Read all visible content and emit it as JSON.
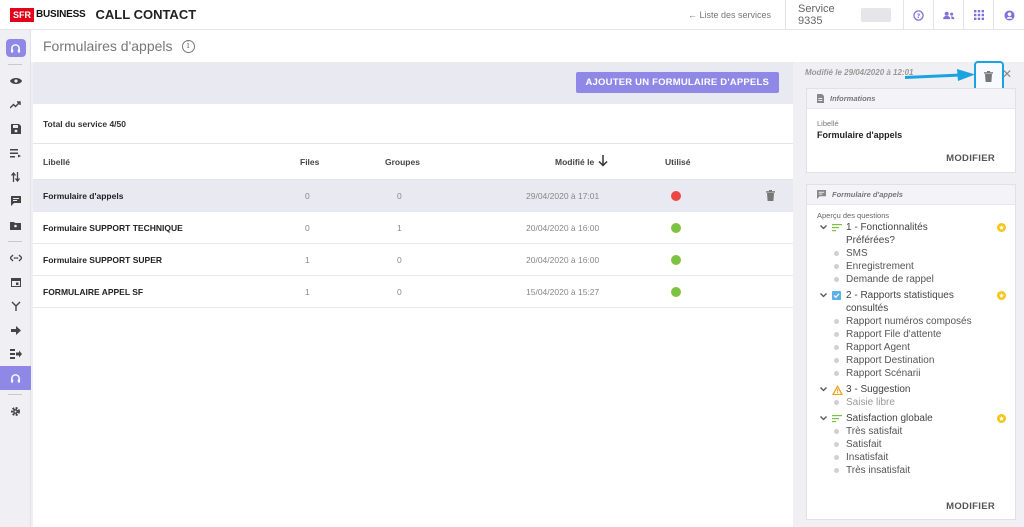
{
  "app": {
    "brand_box": "SFR",
    "brand_text": "BUSINESS",
    "title": "CALL CONTACT"
  },
  "topbar": {
    "back_link": "← Liste des services",
    "service_label": "Service 9335",
    "icons": [
      "help-icon",
      "users-icon",
      "apps-grid-icon",
      "account-icon"
    ]
  },
  "sidebar": {
    "icons": [
      "headset-icon",
      "eye-icon",
      "trend-icon",
      "save-icon",
      "queue-icon",
      "transfer-icon",
      "message-icon",
      "contact-card-icon",
      "code-icon",
      "calendar-icon",
      "branch-icon",
      "forward-icon",
      "list-forward-icon",
      "headset-icon",
      "settings-icon"
    ]
  },
  "page": {
    "title": "Formulaires d'appels"
  },
  "main": {
    "add_button": "AJOUTER UN FORMULAIRE D'APPELS",
    "total": "Total du service 4/50",
    "columns": {
      "libelle": "Libellé",
      "files": "Files",
      "groupes": "Groupes",
      "modifie": "Modifié le",
      "utilise": "Utilisé"
    },
    "rows": [
      {
        "libelle": "Formulaire d'appels",
        "files": "0",
        "groupes": "0",
        "modifie": "29/04/2020 à 17:01",
        "utilise": "red"
      },
      {
        "libelle": "Formulaire SUPPORT TECHNIQUE",
        "files": "0",
        "groupes": "1",
        "modifie": "20/04/2020 à 16:00",
        "utilise": "green"
      },
      {
        "libelle": "Formulaire SUPPORT SUPER",
        "files": "1",
        "groupes": "0",
        "modifie": "20/04/2020 à 16:00",
        "utilise": "green"
      },
      {
        "libelle": "FORMULAIRE APPEL SF",
        "files": "1",
        "groupes": "0",
        "modifie": "15/04/2020 à 15:27",
        "utilise": "green"
      }
    ],
    "colors": {
      "red": "#ef4444",
      "green": "#7cc243"
    }
  },
  "panel": {
    "modified": "Modifié le 29/04/2020 à 12:01",
    "info_title": "Informations",
    "libelle_label": "Libellé",
    "libelle_value": "Formulaire d'appels",
    "modify": "MODIFIER",
    "form_title": "Formulaire d'appels",
    "apercu": "Aperçu des questions",
    "q1": {
      "label": "1 - Fonctionnalités",
      "label2": "Préférées?",
      "options": [
        "SMS",
        "Enregistrement",
        "Demande de rappel"
      ]
    },
    "q2": {
      "label": "2 - Rapports statistiques",
      "label2": "consultés",
      "options": [
        "Rapport numéros composés",
        "Rapport File d'attente",
        "Rapport Agent",
        "Rapport Destination",
        "Rapport Scénarii"
      ]
    },
    "q3": {
      "label": "3 - Suggestion",
      "options": [
        "Saisie libre"
      ]
    },
    "q4": {
      "label": "Satisfaction globale",
      "options": [
        "Très satisfait",
        "Satisfait",
        "Insatisfait",
        "Très insatisfait"
      ]
    },
    "modify2": "MODIFIER"
  }
}
